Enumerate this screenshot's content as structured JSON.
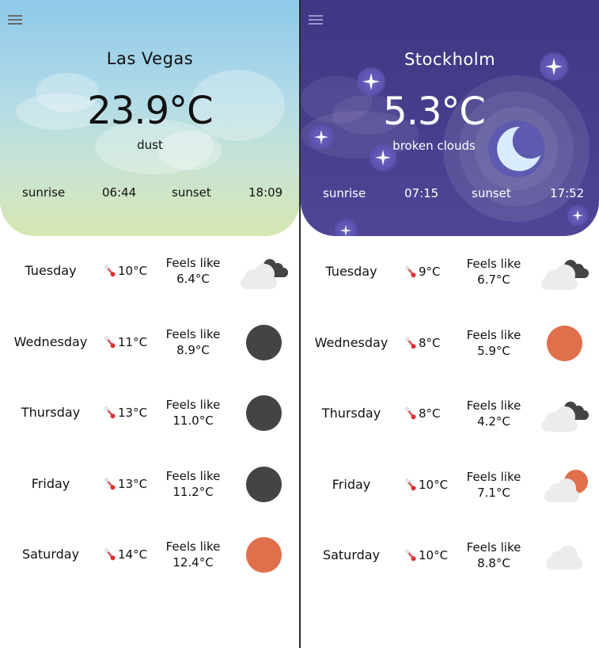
{
  "left": {
    "city": "Las Vegas",
    "temperature": "23.9°C",
    "description": "dust",
    "sunrise_label": "sunrise",
    "sunrise_time": "06:44",
    "sunset_label": "sunset",
    "sunset_time": "18:09",
    "forecast": [
      {
        "day": "Tuesday",
        "temp": "10°C",
        "feels_label": "Feels like",
        "feels": "6.4°C",
        "icon": "dark-cloud-icon"
      },
      {
        "day": "Wednesday",
        "temp": "11°C",
        "feels_label": "Feels like",
        "feels": "8.9°C",
        "icon": "dust-icon"
      },
      {
        "day": "Thursday",
        "temp": "13°C",
        "feels_label": "Feels like",
        "feels": "11.0°C",
        "icon": "dust-icon"
      },
      {
        "day": "Friday",
        "temp": "13°C",
        "feels_label": "Feels like",
        "feels": "11.2°C",
        "icon": "dust-icon"
      },
      {
        "day": "Saturday",
        "temp": "14°C",
        "feels_label": "Feels like",
        "feels": "12.4°C",
        "icon": "sun-icon"
      }
    ]
  },
  "right": {
    "city": "Stockholm",
    "temperature": "5.3°C",
    "description": "broken clouds",
    "sunrise_label": "sunrise",
    "sunrise_time": "07:15",
    "sunset_label": "sunset",
    "sunset_time": "17:52",
    "forecast": [
      {
        "day": "Tuesday",
        "temp": "9°C",
        "feels_label": "Feels like",
        "feels": "6.7°C",
        "icon": "dark-cloud-icon"
      },
      {
        "day": "Wednesday",
        "temp": "8°C",
        "feels_label": "Feels like",
        "feels": "5.9°C",
        "icon": "sun-icon"
      },
      {
        "day": "Thursday",
        "temp": "8°C",
        "feels_label": "Feels like",
        "feels": "4.2°C",
        "icon": "dark-cloud-icon"
      },
      {
        "day": "Friday",
        "temp": "10°C",
        "feels_label": "Feels like",
        "feels": "7.1°C",
        "icon": "partly-sunny-icon"
      },
      {
        "day": "Saturday",
        "temp": "10°C",
        "feels_label": "Feels like",
        "feels": "8.8°C",
        "icon": "cloud-icon"
      }
    ]
  },
  "colors": {
    "day_sky_top": "#8ec9e9",
    "day_sky_bottom": "#d7e6b2",
    "night_sky": "#443c8a",
    "sun": "#e0704b",
    "dust": "#444444",
    "moon": "#d9ecff"
  }
}
